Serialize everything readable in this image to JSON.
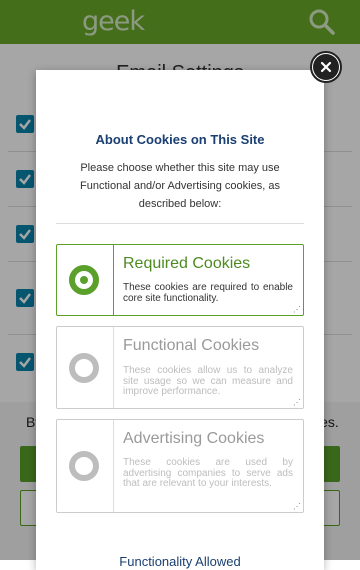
{
  "app": {
    "logo_text": "geek"
  },
  "background": {
    "title": "Email Settings",
    "footer_text_left": "By",
    "footer_text_right": "kies."
  },
  "modal": {
    "title": "About Cookies on This Site",
    "description": "Please choose whether this site may use Functional and/or Advertising cookies, as described below:",
    "options": [
      {
        "title": "Required Cookies",
        "text": "These cookies are required to enable core site functionality.",
        "selected": true
      },
      {
        "title": "Functional Cookies",
        "text": "These cookies allow us to analyze site usage so we can measure and improve performance.",
        "selected": false
      },
      {
        "title": "Advertising Cookies",
        "text": "These cookies are used by advertising companies to serve ads that are relevant to your interests.",
        "selected": false
      }
    ],
    "link_text": "Functionality Allowed"
  },
  "colors": {
    "brand_green": "#6aaa2a",
    "accent_blue": "#1a3f72",
    "check_blue": "#0a84ab"
  },
  "icons": {
    "search": "search-icon",
    "close": "close-icon"
  }
}
